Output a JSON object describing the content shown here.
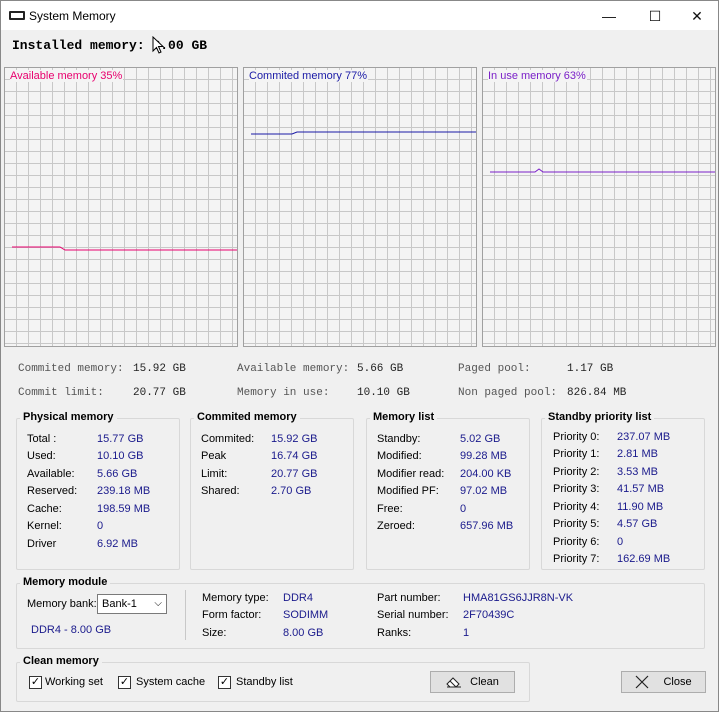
{
  "window": {
    "title": "System Memory",
    "minimize_glyph": "—",
    "maximize_glyph": "☐",
    "close_glyph": "✕"
  },
  "installed": {
    "label": "Installed memory: ",
    "value": "8.00 GB"
  },
  "graphs": [
    {
      "label": "Available memory 35%",
      "color": "#e8006e",
      "level_percent": 35
    },
    {
      "label": "Commited memory 77%",
      "color": "#1a1aa6",
      "level_percent": 77
    },
    {
      "label": "In use memory 63%",
      "color": "#7a1fc8",
      "level_percent": 63
    }
  ],
  "summary": {
    "commited_memory": {
      "label": "Commited memory:",
      "value": "15.92 GB"
    },
    "commit_limit": {
      "label": "Commit limit:",
      "value": "20.77 GB"
    },
    "available_memory": {
      "label": "Available memory:",
      "value": "5.66 GB"
    },
    "memory_in_use": {
      "label": "Memory in use:",
      "value": "10.10 GB"
    },
    "paged_pool": {
      "label": "Paged pool:",
      "value": "1.17 GB"
    },
    "non_paged_pool": {
      "label": "Non paged pool:",
      "value": "826.84 MB"
    }
  },
  "physical": {
    "title": "Physical memory",
    "rows": [
      {
        "label": "Total :",
        "value": "15.77 GB"
      },
      {
        "label": "Used:",
        "value": "10.10 GB"
      },
      {
        "label": "Available:",
        "value": "5.66 GB"
      },
      {
        "label": "Reserved:",
        "value": "239.18 MB"
      },
      {
        "label": "Cache:",
        "value": "198.59 MB"
      },
      {
        "label": "Kernel:",
        "value": "0"
      },
      {
        "label": "Driver",
        "value": "6.92 MB"
      }
    ]
  },
  "commited": {
    "title": "Commited memory",
    "rows": [
      {
        "label": "Commited:",
        "value": "15.92 GB"
      },
      {
        "label": "Peak",
        "value": "16.74 GB"
      },
      {
        "label": "Limit:",
        "value": "20.77 GB"
      },
      {
        "label": "Shared:",
        "value": "2.70 GB"
      }
    ]
  },
  "memlist": {
    "title": "Memory list",
    "rows": [
      {
        "label": "Standby:",
        "value": "5.02 GB"
      },
      {
        "label": "Modified:",
        "value": "99.28 MB"
      },
      {
        "label": "Modifier read:",
        "value": "204.00 KB"
      },
      {
        "label": "Modified PF:",
        "value": "97.02 MB"
      },
      {
        "label": "Free:",
        "value": "0"
      },
      {
        "label": "Zeroed:",
        "value": "657.96 MB"
      }
    ]
  },
  "standby": {
    "title": "Standby priority list",
    "rows": [
      {
        "label": "Priority 0:",
        "value": "237.07 MB"
      },
      {
        "label": "Priority 1:",
        "value": "2.81 MB"
      },
      {
        "label": "Priority 2:",
        "value": "3.53 MB"
      },
      {
        "label": "Priority 3:",
        "value": "41.57 MB"
      },
      {
        "label": "Priority 4:",
        "value": "11.90 MB"
      },
      {
        "label": "Priority 5:",
        "value": "4.57 GB"
      },
      {
        "label": "Priority 6:",
        "value": "0"
      },
      {
        "label": "Priority 7:",
        "value": "162.69 MB"
      }
    ]
  },
  "module": {
    "title": "Memory module",
    "bank_label": "Memory bank:",
    "bank_selected": "Bank-1",
    "summary": "DDR4 - 8.00 GB",
    "memory_type": {
      "label": "Memory type:",
      "value": "DDR4"
    },
    "form_factor": {
      "label": "Form factor:",
      "value": "SODIMM"
    },
    "size": {
      "label": "Size:",
      "value": "8.00 GB"
    },
    "part_number": {
      "label": "Part number:",
      "value": "HMA81GS6JJR8N-VK"
    },
    "serial_number": {
      "label": "Serial number:",
      "value": "2F70439C"
    },
    "ranks": {
      "label": "Ranks:",
      "value": "1"
    }
  },
  "clean": {
    "title": "Clean memory",
    "working_set": {
      "label": "Working set",
      "checked": true
    },
    "system_cache": {
      "label": "System cache",
      "checked": true
    },
    "standby_list": {
      "label": "Standby list",
      "checked": true
    },
    "clean_label": "Clean",
    "close_label": "Close"
  },
  "icons": {
    "app": "memory-chip-icon",
    "clean": "eraser-icon",
    "close": "close-x-icon",
    "dropdown": "chevron-down-icon",
    "cursor": "mouse-pointer-icon"
  }
}
